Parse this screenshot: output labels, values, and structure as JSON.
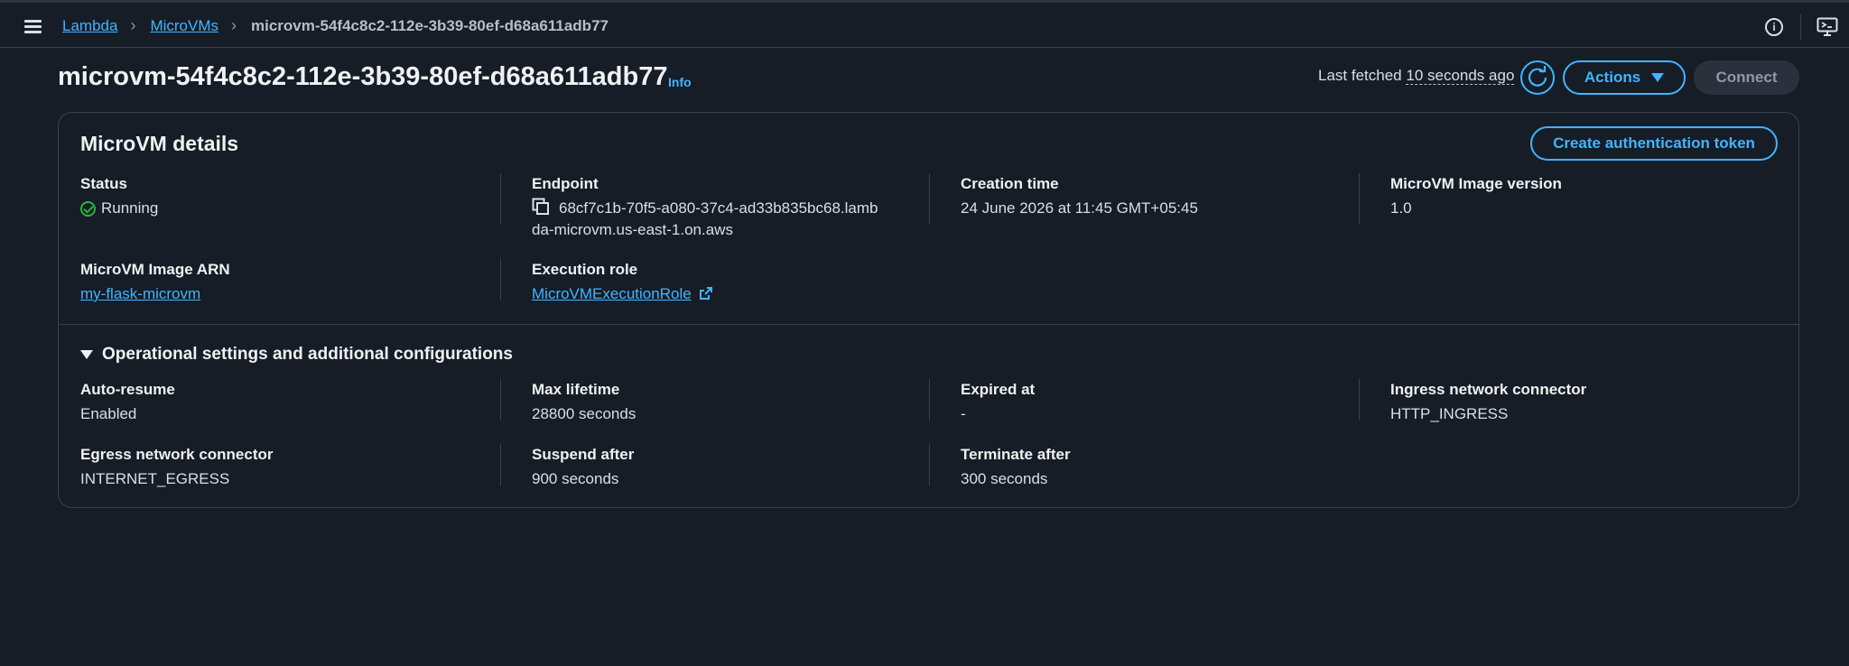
{
  "breadcrumb": {
    "items": [
      "Lambda",
      "MicroVMs"
    ],
    "current": "microvm-54f4c8c2-112e-3b39-80ef-d68a611adb77"
  },
  "header": {
    "title": "microvm-54f4c8c2-112e-3b39-80ef-d68a611adb77",
    "info_label": "Info",
    "last_fetched_prefix": "Last fetched",
    "last_fetched_value": "10 seconds ago",
    "actions_label": "Actions",
    "connect_label": "Connect"
  },
  "details": {
    "title": "MicroVM details",
    "auth_button": "Create authentication token",
    "status_label": "Status",
    "status_value": "Running",
    "endpoint_label": "Endpoint",
    "endpoint_line1": "68cf7c1b-70f5-a080-37c4-ad33b835bc68.lamb",
    "endpoint_line2": "da-microvm.us-east-1.on.aws",
    "creation_label": "Creation time",
    "creation_value": "24 June 2026 at 11:45 GMT+05:45",
    "image_version_label": "MicroVM Image version",
    "image_version_value": "1.0",
    "image_arn_label": "MicroVM Image ARN",
    "image_arn_value": "my-flask-microvm",
    "exec_role_label": "Execution role",
    "exec_role_value": "MicroVMExecutionRole"
  },
  "operational": {
    "title": "Operational settings and additional configurations",
    "auto_resume_label": "Auto-resume",
    "auto_resume_value": "Enabled",
    "max_lifetime_label": "Max lifetime",
    "max_lifetime_value": "28800 seconds",
    "expired_label": "Expired at",
    "expired_value": "-",
    "ingress_label": "Ingress network connector",
    "ingress_value": "HTTP_INGRESS",
    "egress_label": "Egress network connector",
    "egress_value": "INTERNET_EGRESS",
    "suspend_label": "Suspend after",
    "suspend_value": "900 seconds",
    "terminate_label": "Terminate after",
    "terminate_value": "300 seconds"
  },
  "icons": [
    "menu-icon",
    "chevron-right-icon",
    "info-icon",
    "monitor-icon",
    "refresh-icon",
    "caret-down-icon",
    "check-circle-icon",
    "copy-icon",
    "external-link-icon",
    "triangle-down-icon"
  ],
  "colors": {
    "accent": "#42b4ff",
    "success": "#2bb534",
    "background": "#161d26"
  }
}
